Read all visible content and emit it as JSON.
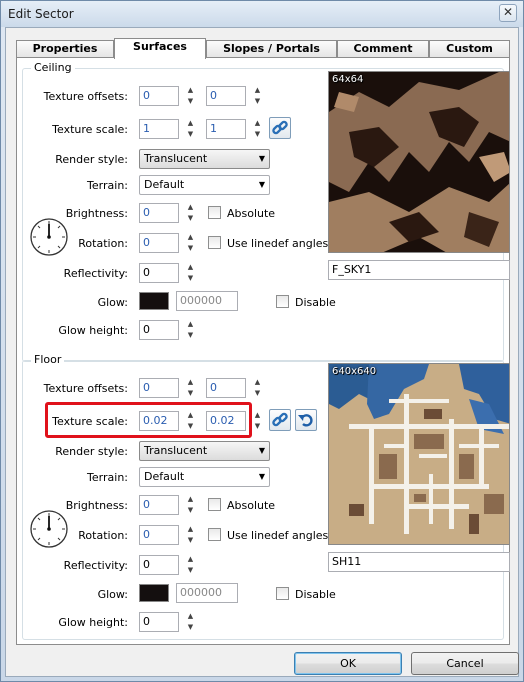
{
  "window": {
    "title": "Edit Sector",
    "close_glyph": "✕"
  },
  "tabs": [
    {
      "label": "Properties",
      "active": false
    },
    {
      "label": "Surfaces",
      "active": true
    },
    {
      "label": "Slopes / Portals",
      "active": false
    },
    {
      "label": "Comment",
      "active": false
    },
    {
      "label": "Custom",
      "active": false
    }
  ],
  "labels": {
    "texture_offsets": "Texture offsets:",
    "texture_scale": "Texture scale:",
    "render_style": "Render style:",
    "terrain": "Terrain:",
    "brightness": "Brightness:",
    "rotation": "Rotation:",
    "reflectivity": "Reflectivity:",
    "glow": "Glow:",
    "glow_height": "Glow height:",
    "absolute": "Absolute",
    "use_linedef_angles": "Use linedef angles",
    "disable": "Disable"
  },
  "ceiling": {
    "group_title": "Ceiling",
    "offset_x": "0",
    "offset_y": "0",
    "scale_x": "1",
    "scale_y": "1",
    "render_style": "Translucent",
    "terrain": "Default",
    "brightness": "0",
    "rotation": "0",
    "reflectivity": "0",
    "glow_color": "000000",
    "glow_height": "0",
    "texture_size": "64x64",
    "texture_name": "F_SKY1"
  },
  "floor": {
    "group_title": "Floor",
    "offset_x": "0",
    "offset_y": "0",
    "scale_x": "0.02",
    "scale_y": "0.02",
    "render_style": "Translucent",
    "terrain": "Default",
    "brightness": "0",
    "rotation": "0",
    "reflectivity": "0",
    "glow_color": "000000",
    "glow_height": "0",
    "texture_size": "640x640",
    "texture_name": "SH11"
  },
  "buttons": {
    "ok": "OK",
    "cancel": "Cancel"
  },
  "icons": {
    "link": "link-icon",
    "reset": "reset-icon",
    "spin_up": "▲",
    "spin_down": "▼",
    "dropdown": "▼"
  },
  "colors": {
    "highlight": "#e0111b",
    "accent_text": "#2a5db0"
  }
}
